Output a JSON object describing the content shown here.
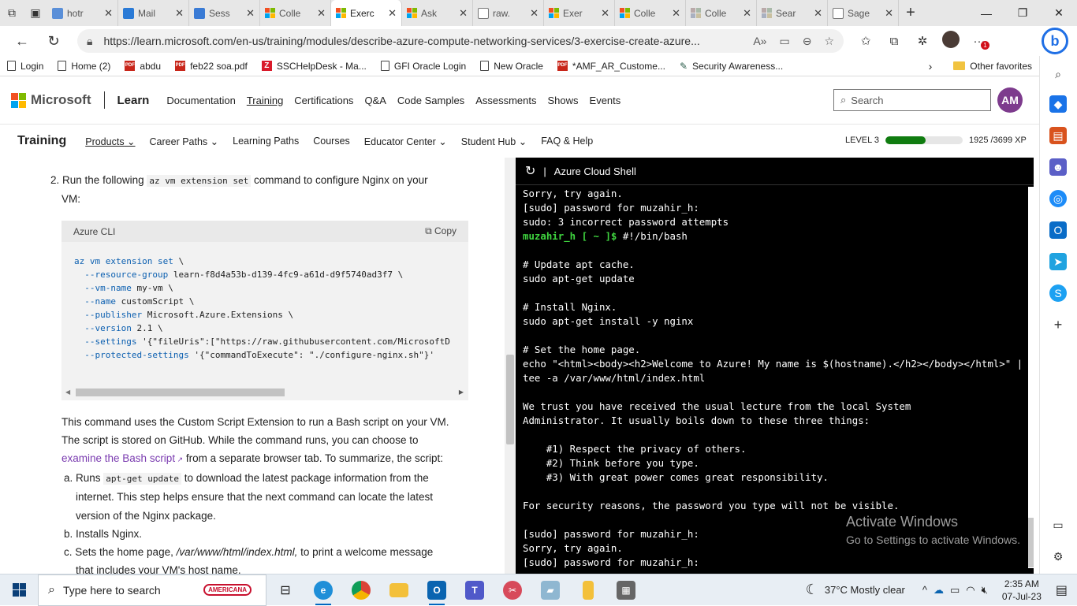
{
  "browser": {
    "tabs": [
      {
        "label": "hotr",
        "fav": "search",
        "active": false
      },
      {
        "label": "Mail",
        "fav": "outlook",
        "active": false
      },
      {
        "label": "Sess",
        "fav": "azure",
        "active": false
      },
      {
        "label": "Colle",
        "fav": "ms",
        "active": false
      },
      {
        "label": "Exerc",
        "fav": "ms",
        "active": true
      },
      {
        "label": "Ask",
        "fav": "ms",
        "active": false
      },
      {
        "label": "raw.",
        "fav": "page",
        "active": false
      },
      {
        "label": "Exer",
        "fav": "ms",
        "active": false
      },
      {
        "label": "Colle",
        "fav": "ms",
        "active": false
      },
      {
        "label": "Colle",
        "fav": "ms-grey",
        "active": false
      },
      {
        "label": "Sear",
        "fav": "ms-grey",
        "active": false
      },
      {
        "label": "Sage",
        "fav": "page",
        "active": false
      }
    ],
    "url": "https://learn.microsoft.com/en-us/training/modules/describe-azure-compute-networking-services/3-exercise-create-azure...",
    "notification_count": "1",
    "favorites": [
      {
        "label": "Login",
        "icon": "doc"
      },
      {
        "label": "Home (2)",
        "icon": "doc"
      },
      {
        "label": "abdu",
        "icon": "pdf"
      },
      {
        "label": "feb22 soa.pdf",
        "icon": "pdf"
      },
      {
        "label": "SSCHelpDesk - Ma...",
        "icon": "z"
      },
      {
        "label": "GFI Oracle Login",
        "icon": "doc"
      },
      {
        "label": "New Oracle",
        "icon": "doc"
      },
      {
        "label": "*AMF_AR_Custome...",
        "icon": "pdf"
      },
      {
        "label": "Security Awareness...",
        "icon": "bird"
      }
    ],
    "other_favorites": "Other favorites"
  },
  "site": {
    "brand": "Microsoft",
    "product": "Learn",
    "nav": [
      "Documentation",
      "Training",
      "Certifications",
      "Q&A",
      "Code Samples",
      "Assessments",
      "Shows",
      "Events"
    ],
    "active_nav": "Training",
    "search_placeholder": "Search",
    "avatar": "AM"
  },
  "training": {
    "title": "Training",
    "nav": [
      "Products",
      "Career Paths",
      "Learning Paths",
      "Courses",
      "Educator Center",
      "Student Hub",
      "FAQ & Help"
    ],
    "level_label": "LEVEL 3",
    "xp": "1925 /3699 XP",
    "progress": 0.52
  },
  "article": {
    "step2_num": "2.",
    "step2_a": "Run the following",
    "step2_code": "az vm extension set",
    "step2_b": "command to configure Nginx on your",
    "step2_c": "VM:",
    "cli_lang": "Azure CLI",
    "copy": "Copy",
    "code_lines": [
      "az vm extension set \\",
      "  --resource-group learn-f8d4a53b-d139-4fc9-a61d-d9f5740ad3f7 \\",
      "  --vm-name my-vm \\",
      "  --name customScript \\",
      "  --publisher Microsoft.Azure.Extensions \\",
      "  --version 2.1 \\",
      "  --settings '{\"fileUris\":[\"https://raw.githubusercontent.com/MicrosoftD",
      "  --protected-settings '{\"commandToExecute\": \"./configure-nginx.sh\"}'"
    ],
    "para1": "This command uses the Custom Script Extension to run a Bash script on your VM.",
    "para2": "The script is stored on GitHub. While the command runs, you can choose to",
    "link": "examine the Bash script",
    "para3": "from a separate browser tab. To summarize, the script:",
    "list": {
      "a_pre": "a. Runs",
      "a_code": "apt-get update",
      "a_post": "to download the latest package information from the",
      "a2": "internet. This step helps ensure that the next command can locate the latest",
      "a3": "version of the Nginx package.",
      "b": "b. Installs Nginx.",
      "c_pre": "c. Sets the home page,",
      "c_em": "/var/www/html/index.html,",
      "c_post": "to print a welcome message",
      "c2": "that includes your VM's host name."
    }
  },
  "shell": {
    "title": "Azure Cloud Shell",
    "lines": [
      "Sorry, try again.",
      "[sudo] password for muzahir_h:",
      "sudo: 3 incorrect password attempts",
      "#!/bin/bash",
      "",
      "# Update apt cache.",
      "sudo apt-get update",
      "",
      "# Install Nginx.",
      "sudo apt-get install -y nginx",
      "",
      "# Set the home page.",
      "echo \"<html><body><h2>Welcome to Azure! My name is $(hostname).</h2></body></html>\" | sudo",
      "tee -a /var/www/html/index.html",
      "",
      "We trust you have received the usual lecture from the local System",
      "Administrator. It usually boils down to these three things:",
      "",
      "    #1) Respect the privacy of others.",
      "    #2) Think before you type.",
      "    #3) With great power comes great responsibility.",
      "",
      "For security reasons, the password you type will not be visible.",
      "",
      "[sudo] password for muzahir_h:",
      "Sorry, try again.",
      "[sudo] password for muzahir_h:"
    ],
    "prompt_user": "muzahir_h",
    "prompt_rest": " [ ~ ]$ ",
    "prompt_line_index": 3
  },
  "watermark": {
    "line1": "Activate Windows",
    "line2": "Go to Settings to activate Windows."
  },
  "taskbar": {
    "search_placeholder": "Type here to search",
    "promo": "AMERICANA",
    "weather": "37°C  Mostly clear",
    "time": "2:35 AM",
    "date": "07-Jul-23"
  },
  "colors": {
    "accent": "#0067b8",
    "prompt_green": "#3fd43f",
    "level_green": "#107c10"
  }
}
